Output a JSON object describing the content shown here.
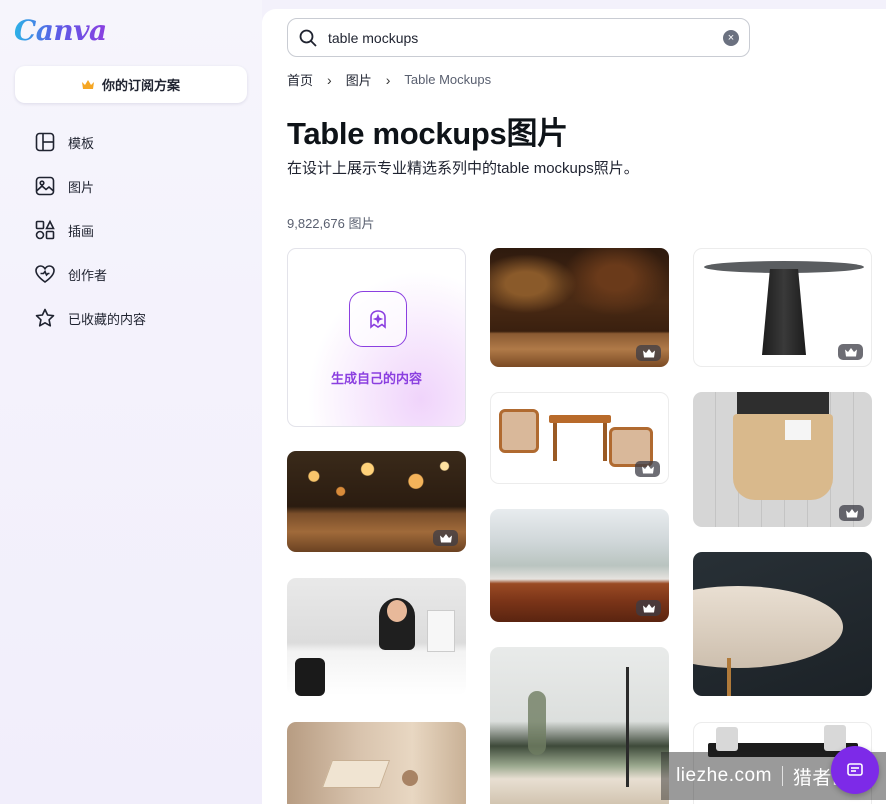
{
  "app": {
    "logo_text": "Canva",
    "brand_color": "#7d2ae8"
  },
  "sidebar": {
    "plan_label": "你的订阅方案",
    "items": [
      {
        "label": "模板",
        "icon": "template-icon"
      },
      {
        "label": "图片",
        "icon": "image-icon"
      },
      {
        "label": "插画",
        "icon": "illustration-icon"
      },
      {
        "label": "创作者",
        "icon": "creator-heart-icon"
      },
      {
        "label": "已收藏的内容",
        "icon": "star-icon"
      }
    ]
  },
  "search": {
    "value": "table mockups",
    "placeholder": ""
  },
  "breadcrumb": {
    "items": [
      "首页",
      "图片",
      "Table Mockups"
    ]
  },
  "page": {
    "title": "Table mockups图片",
    "subtitle": "在设计上展示专业精选系列中的table mockups照片。",
    "count": "9,822,676 图片"
  },
  "generate_card": {
    "label": "生成自己的内容"
  },
  "watermark": {
    "left": "liezhe.com",
    "right": "猎者出海"
  }
}
